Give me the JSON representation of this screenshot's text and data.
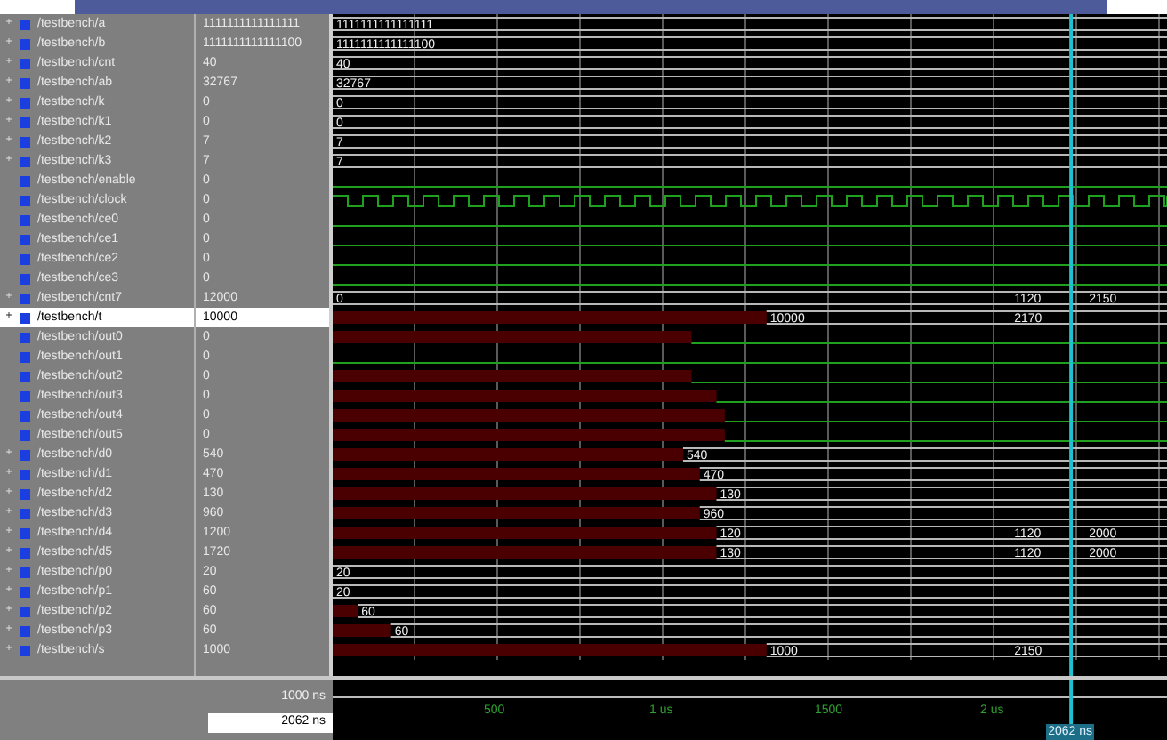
{
  "signals": [
    {
      "name": "/testbench/a",
      "value": "1111111111111111",
      "kind": "bus",
      "expandable": true,
      "selected": false,
      "wave_labels": [
        "1111111111111111"
      ]
    },
    {
      "name": "/testbench/b",
      "value": "1111111111111100",
      "kind": "bus",
      "expandable": true,
      "selected": false,
      "wave_labels": [
        "1111111111111100"
      ]
    },
    {
      "name": "/testbench/cnt",
      "value": "40",
      "kind": "bus",
      "expandable": true,
      "selected": false,
      "wave_labels": [
        "40"
      ]
    },
    {
      "name": "/testbench/ab",
      "value": "32767",
      "kind": "bus",
      "expandable": true,
      "selected": false,
      "wave_labels": [
        "32767"
      ]
    },
    {
      "name": "/testbench/k",
      "value": "0",
      "kind": "bus",
      "expandable": true,
      "selected": false,
      "wave_labels": [
        "0"
      ]
    },
    {
      "name": "/testbench/k1",
      "value": "0",
      "kind": "bus",
      "expandable": true,
      "selected": false,
      "wave_labels": [
        "0"
      ]
    },
    {
      "name": "/testbench/k2",
      "value": "7",
      "kind": "bus",
      "expandable": true,
      "selected": false,
      "wave_labels": [
        "7"
      ]
    },
    {
      "name": "/testbench/k3",
      "value": "7",
      "kind": "bus",
      "expandable": true,
      "selected": false,
      "wave_labels": [
        "7"
      ]
    },
    {
      "name": "/testbench/enable",
      "value": "0",
      "kind": "bit",
      "selected": false
    },
    {
      "name": "/testbench/clock",
      "value": "0",
      "kind": "clock",
      "selected": false
    },
    {
      "name": "/testbench/ce0",
      "value": "0",
      "kind": "bit",
      "selected": false
    },
    {
      "name": "/testbench/ce1",
      "value": "0",
      "kind": "bit",
      "selected": false
    },
    {
      "name": "/testbench/ce2",
      "value": "0",
      "kind": "bit",
      "selected": false
    },
    {
      "name": "/testbench/ce3",
      "value": "0",
      "kind": "bit",
      "selected": false
    },
    {
      "name": "/testbench/cnt7",
      "value": "12000",
      "kind": "bus",
      "expandable": true,
      "selected": false,
      "wave_labels": [
        "0",
        "1120",
        "2150"
      ]
    },
    {
      "name": "/testbench/t",
      "value": "10000",
      "kind": "bus",
      "expandable": true,
      "selected": true,
      "level": 0.52,
      "wave_labels": [
        "10000",
        "2170"
      ]
    },
    {
      "name": "/testbench/out0",
      "value": "0",
      "kind": "bit",
      "selected": false,
      "level": 0.43
    },
    {
      "name": "/testbench/out1",
      "value": "0",
      "kind": "bit",
      "selected": false
    },
    {
      "name": "/testbench/out2",
      "value": "0",
      "kind": "bit",
      "selected": false,
      "level": 0.43
    },
    {
      "name": "/testbench/out3",
      "value": "0",
      "kind": "bit",
      "selected": false,
      "level": 0.46
    },
    {
      "name": "/testbench/out4",
      "value": "0",
      "kind": "bit",
      "selected": false,
      "level": 0.47
    },
    {
      "name": "/testbench/out5",
      "value": "0",
      "kind": "bit",
      "selected": false,
      "level": 0.47
    },
    {
      "name": "/testbench/d0",
      "value": "540",
      "kind": "bus",
      "expandable": true,
      "selected": false,
      "level": 0.42,
      "wave_labels": [
        "540"
      ]
    },
    {
      "name": "/testbench/d1",
      "value": "470",
      "kind": "bus",
      "expandable": true,
      "selected": false,
      "level": 0.44,
      "wave_labels": [
        "470"
      ]
    },
    {
      "name": "/testbench/d2",
      "value": "130",
      "kind": "bus",
      "expandable": true,
      "selected": false,
      "level": 0.46,
      "wave_labels": [
        "130"
      ]
    },
    {
      "name": "/testbench/d3",
      "value": "960",
      "kind": "bus",
      "expandable": true,
      "selected": false,
      "level": 0.44,
      "wave_labels": [
        "960"
      ]
    },
    {
      "name": "/testbench/d4",
      "value": "1200",
      "kind": "bus",
      "expandable": true,
      "selected": false,
      "level": 0.46,
      "wave_labels": [
        "120",
        "1120",
        "2000"
      ]
    },
    {
      "name": "/testbench/d5",
      "value": "1720",
      "kind": "bus",
      "expandable": true,
      "selected": false,
      "level": 0.46,
      "wave_labels": [
        "130",
        "1120",
        "2000"
      ]
    },
    {
      "name": "/testbench/p0",
      "value": "20",
      "kind": "bus",
      "expandable": true,
      "selected": false,
      "wave_labels": [
        "20"
      ]
    },
    {
      "name": "/testbench/p1",
      "value": "60",
      "kind": "bus",
      "expandable": true,
      "selected": false,
      "wave_labels": [
        "20"
      ]
    },
    {
      "name": "/testbench/p2",
      "value": "60",
      "kind": "bus",
      "expandable": true,
      "selected": false,
      "level": 0.03,
      "wave_labels": [
        "60"
      ]
    },
    {
      "name": "/testbench/p3",
      "value": "60",
      "kind": "bus",
      "expandable": true,
      "selected": false,
      "level": 0.07,
      "wave_labels": [
        "60"
      ]
    },
    {
      "name": "/testbench/s",
      "value": "1000",
      "kind": "bus",
      "expandable": true,
      "selected": false,
      "level": 0.52,
      "wave_labels": [
        "1000",
        "2150"
      ]
    }
  ],
  "expander_glyph": "+",
  "footer": {
    "now": "1000 ns",
    "cursor_time": "2062 ns"
  },
  "timeline": [
    "500",
    "1 us",
    "1500",
    "2 us"
  ],
  "cursor": {
    "level": 0.885,
    "label": "2062 ns"
  }
}
